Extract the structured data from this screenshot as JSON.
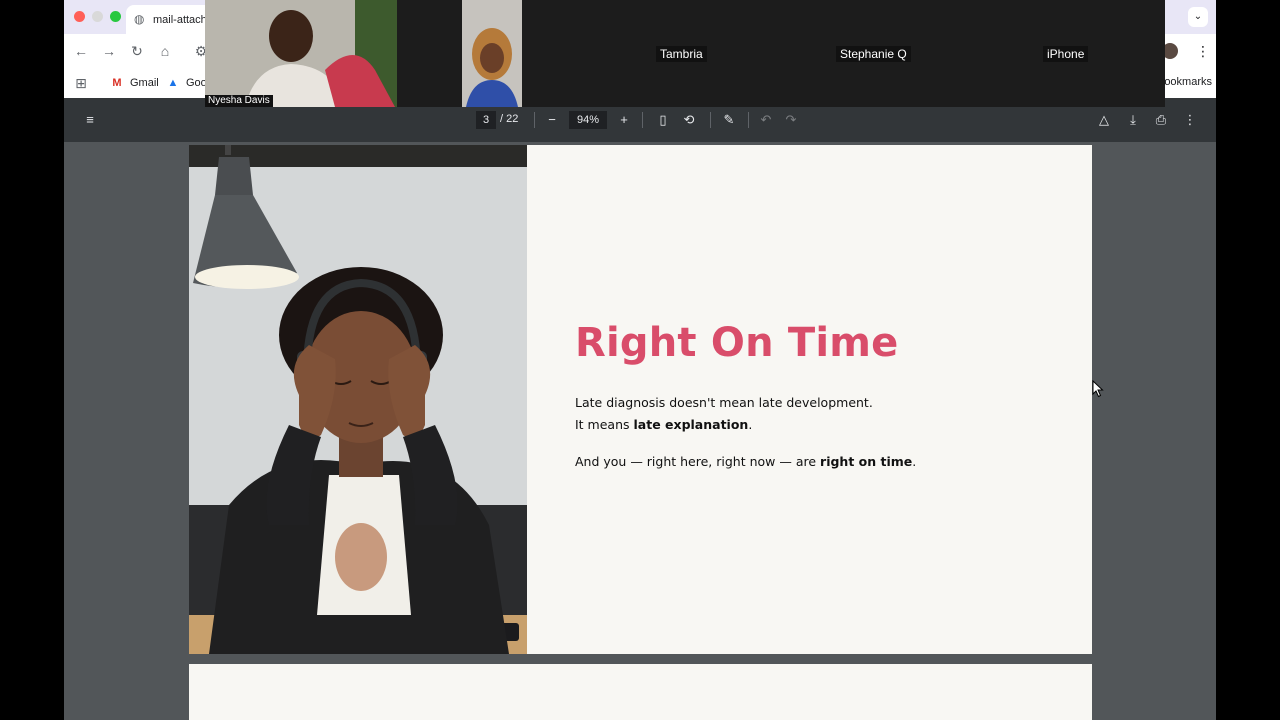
{
  "browser": {
    "tab_title": "mail-attach",
    "bookmarks": [
      {
        "label": "Gmail",
        "icon": "gmail-icon"
      },
      {
        "label": "Goo",
        "icon": "google-drive-icon"
      }
    ],
    "bookmarks_right": "ookmarks"
  },
  "pdf": {
    "current_page": "3",
    "total_pages": "/ 22",
    "zoom": "94%"
  },
  "slide": {
    "title": "Right On Time",
    "line1": "Late diagnosis doesn't mean late development.",
    "line2_prefix": "It means ",
    "line2_bold": "late explanation",
    "line2_suffix": ".",
    "line3_prefix": "And you — right here, right now — are ",
    "line3_bold": "right on time",
    "line3_suffix": "."
  },
  "meeting": {
    "participants": [
      {
        "name": "Nyesha Davis"
      },
      {
        "name": "Tambria"
      },
      {
        "name": "Stephanie Q"
      },
      {
        "name": "iPhone"
      }
    ]
  },
  "colors": {
    "title_accent": "#d94d6a",
    "viewer_bg": "#525659",
    "toolbar_bg": "#323639"
  }
}
